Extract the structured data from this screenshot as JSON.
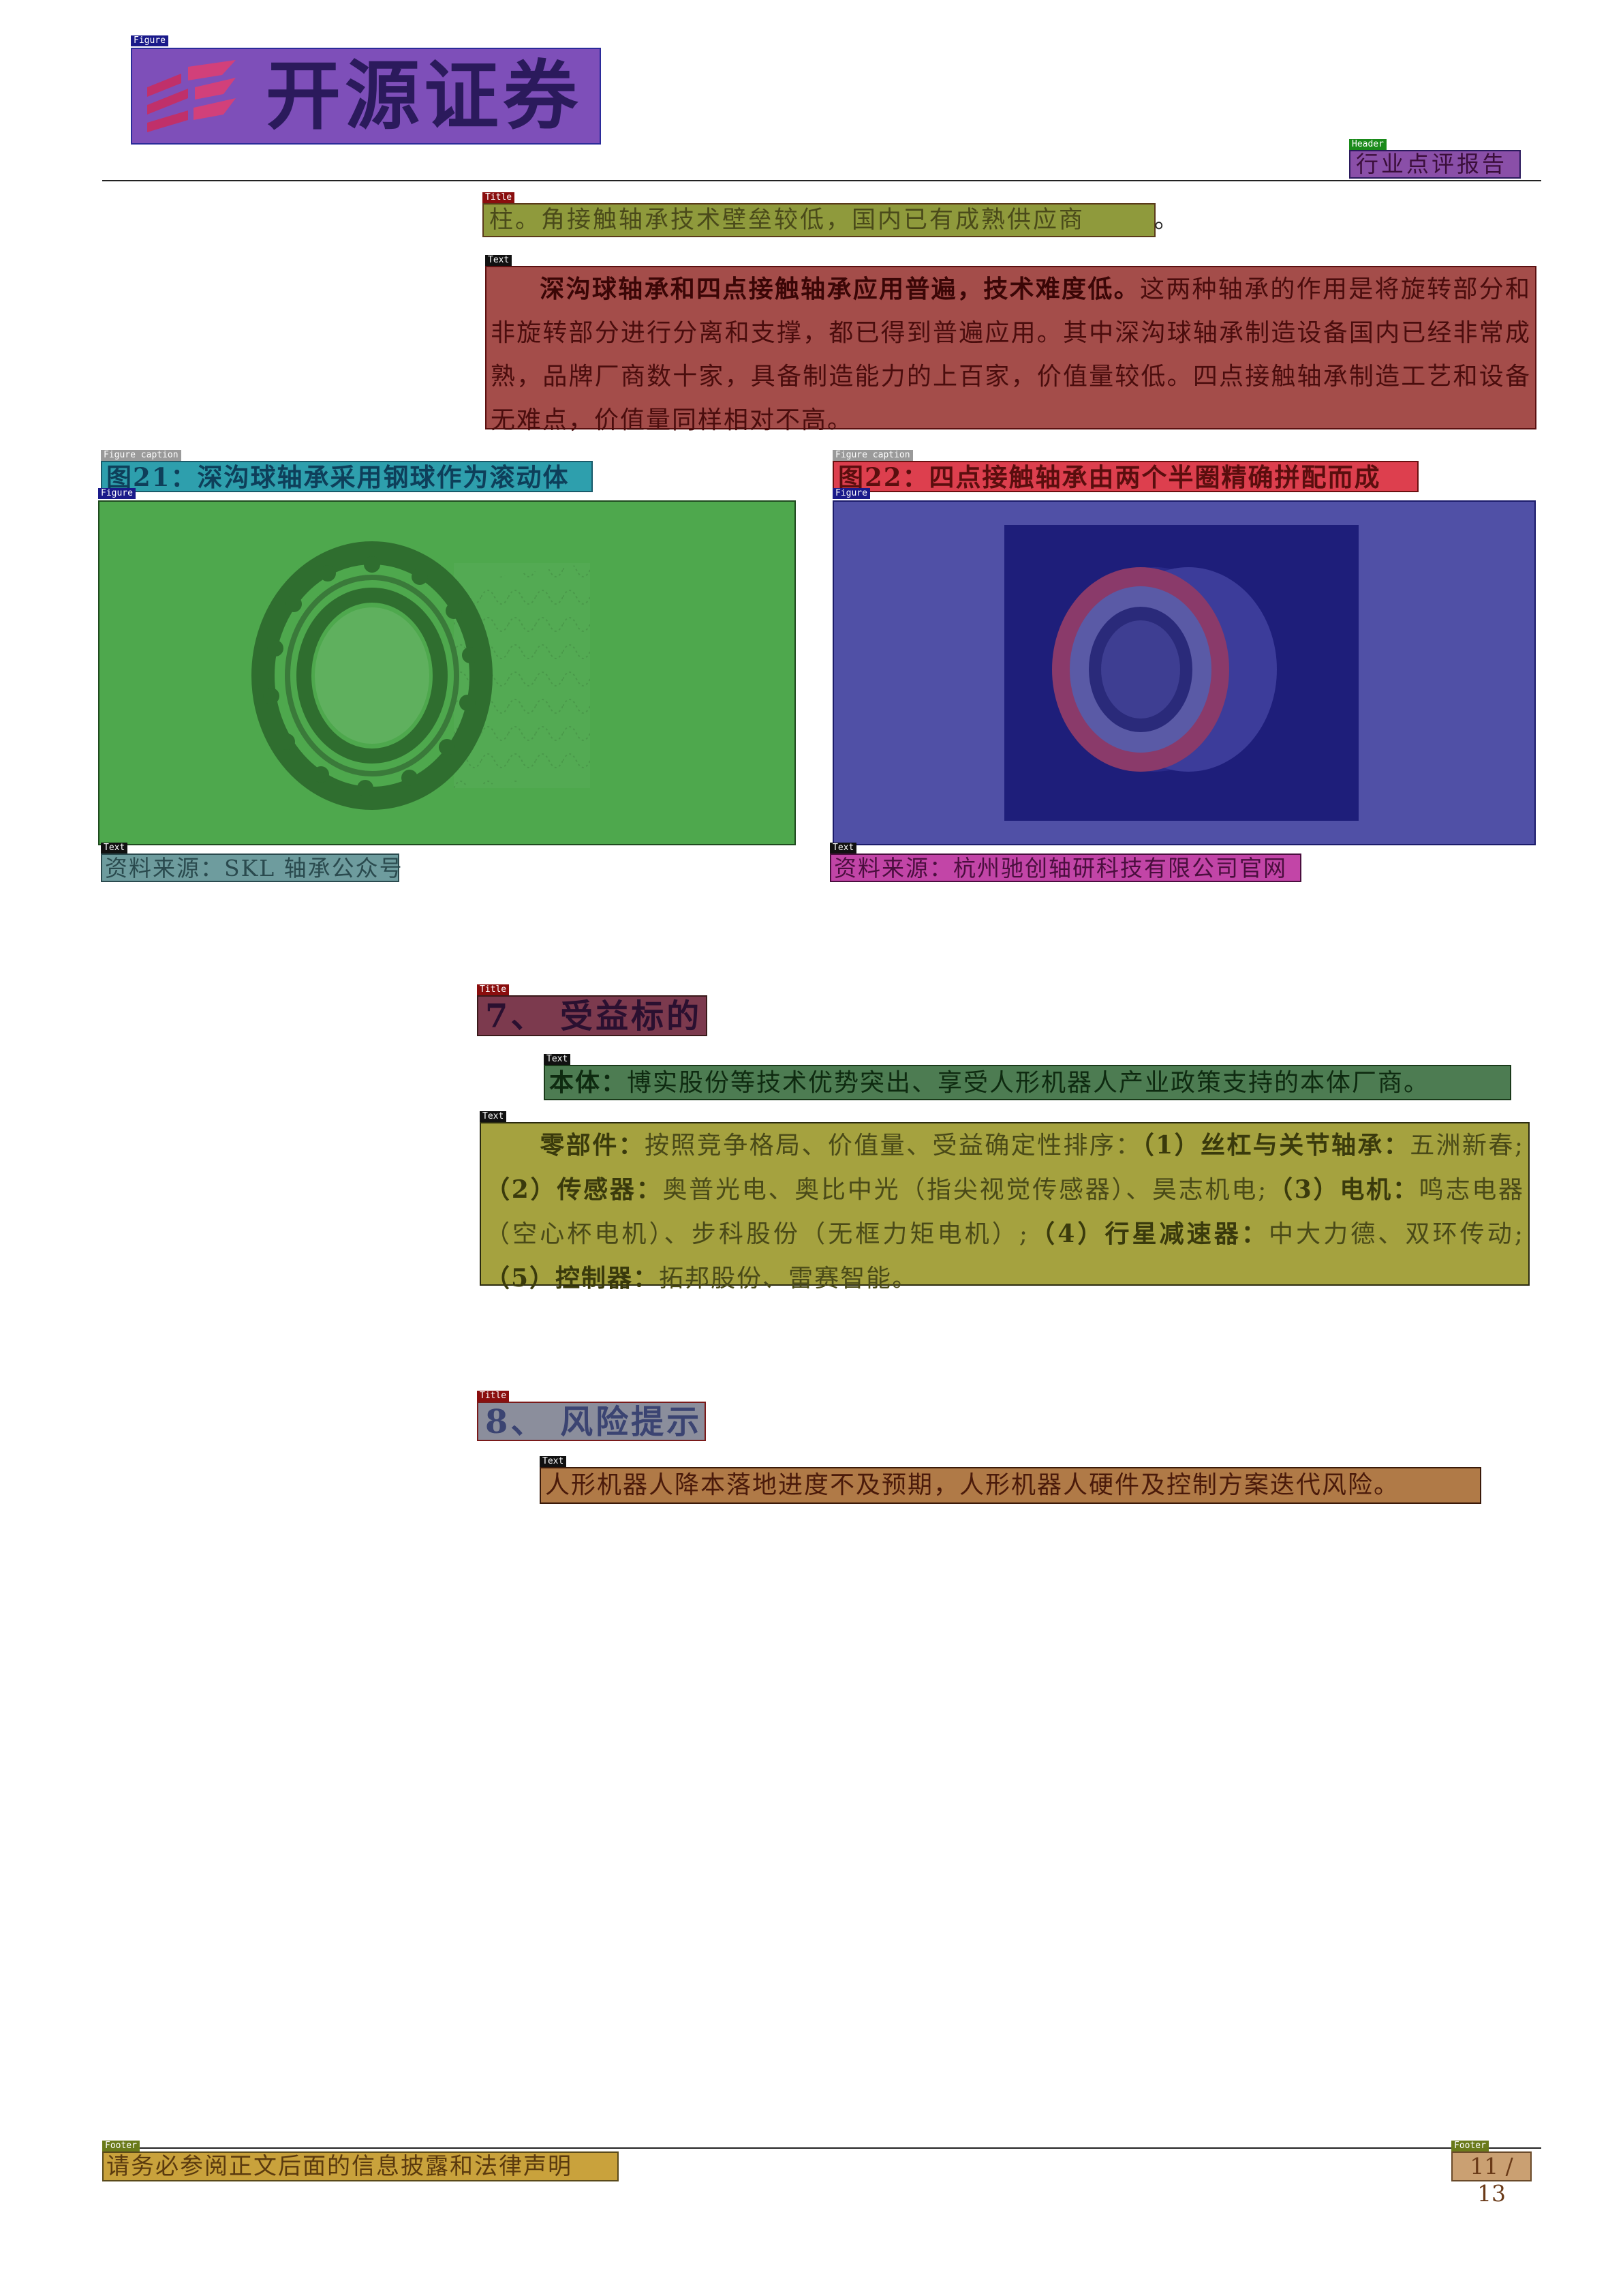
{
  "header": {
    "logo_text": "开源证券",
    "report_type": "行业点评报告"
  },
  "body": {
    "title_top": "柱。角接触轴承技术壁垒较低，国内已有成熟供应商",
    "title_top_period": "。",
    "para1_bold": "深沟球轴承和四点接触轴承应用普遍，技术难度低。",
    "para1_text": "这两种轴承的作用是将旋转部分和非旋转部分进行分离和支撑，都已得到普遍应用。其中深沟球轴承制造设备国内已经非常成熟，品牌厂商数十家，具备制造能力的上百家，价值量较低。四点接触轴承制造工艺和设备无难点，价值量同样相对不高。",
    "figure21": {
      "caption": "图21：深沟球轴承采用钢球作为滚动体",
      "source": "资料来源：SKL 轴承公众号"
    },
    "figure22": {
      "caption": "图22：四点接触轴承由两个半圈精确拼配而成",
      "source": "资料来源：杭州驰创轴研科技有限公司官网"
    },
    "section7": {
      "title": "7、 受益标的",
      "p1_bold": "本体：",
      "p1_text": "博实股份等技术优势突出、享受人形机器人产业政策支持的本体厂商。",
      "p2_bold": "零部件：",
      "p2_a": "按照竞争格局、价值量、受益确定性排序：",
      "p2_b1": "（1）丝杠与关节轴承：",
      "p2_t1": "五洲新春;",
      "p2_b2": "（2）传感器：",
      "p2_t2": "奥普光电、奥比中光（指尖视觉传感器）、昊志机电;",
      "p2_b3": "（3）电机：",
      "p2_t3": "鸣志电器（空心杯电机）、步科股份（无框力矩电机）;",
      "p2_b4": "（4）行星减速器：",
      "p2_t4": "中大力德、双环传动;",
      "p2_b5": "（5）控制器：",
      "p2_t5": "拓邦股份、雷赛智能。"
    },
    "section8": {
      "title": "8、 风险提示",
      "text": "人形机器人降本落地进度不及预期，人形机器人硬件及控制方案迭代风险。"
    }
  },
  "footer": {
    "disclaimer": "请务必参阅正文后面的信息披露和法律声明",
    "page": "11 / 13"
  },
  "tags": {
    "figure": "Figure",
    "header": "Header",
    "title": "Title",
    "text": "Text",
    "figure_caption": "Figure caption",
    "footer": "Footer"
  },
  "colors": {
    "tag_figure": "#1a1a8a",
    "tag_header": "#1a8a1a",
    "tag_title": "#8a0e0e",
    "tag_text": "#111111",
    "tag_caption": "#9a9a9a",
    "tag_footer": "#6a7a1a"
  }
}
